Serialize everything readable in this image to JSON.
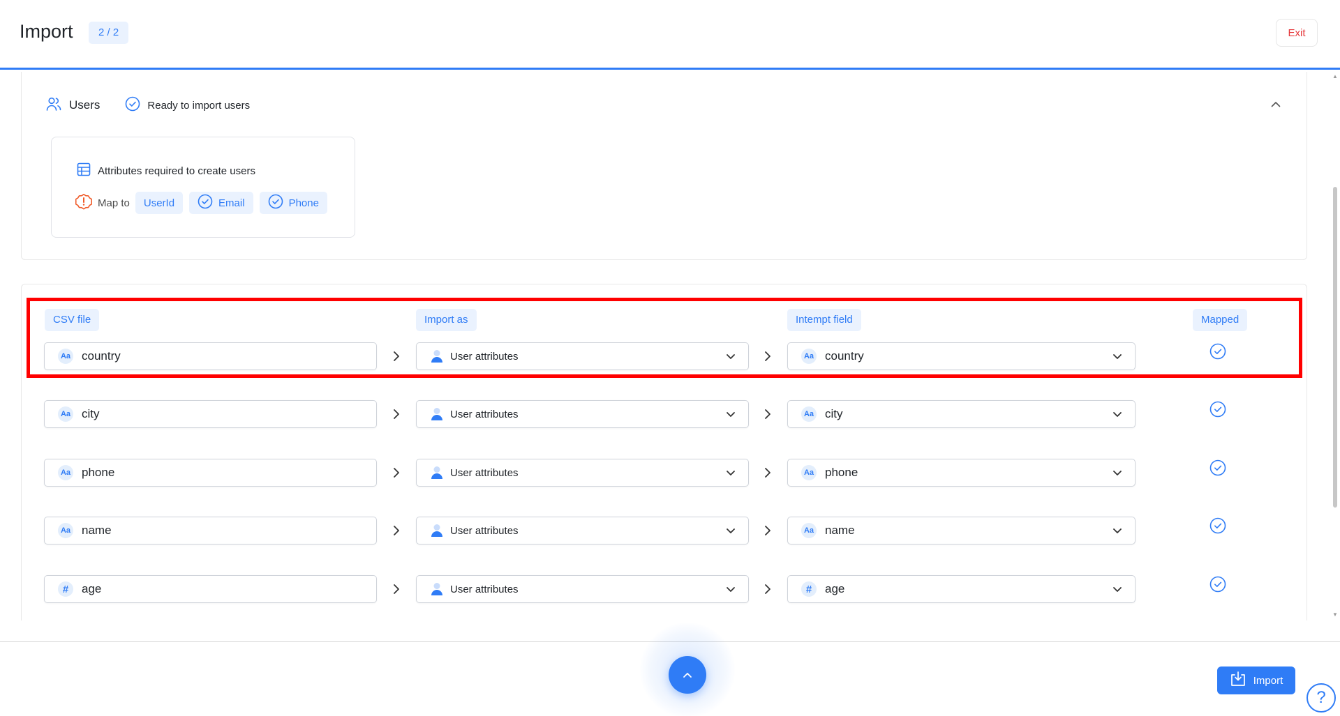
{
  "header": {
    "title": "Import",
    "step": "2 / 2",
    "exit_label": "Exit"
  },
  "users_section": {
    "title": "Users",
    "status": "Ready to import users",
    "required_card": {
      "title": "Attributes required to create users",
      "map_to_label": "Map to",
      "chips": [
        {
          "label": "UserId",
          "checked": false
        },
        {
          "label": "Email",
          "checked": true
        },
        {
          "label": "Phone",
          "checked": true
        }
      ]
    }
  },
  "mapping": {
    "columns": {
      "csv": "CSV file",
      "import_as": "Import as",
      "field": "Intempt field",
      "mapped": "Mapped"
    },
    "rows": [
      {
        "type": "text",
        "type_icon": "Aa",
        "csv": "country",
        "import_as": "User attributes",
        "field": "country",
        "mapped": true
      },
      {
        "type": "text",
        "type_icon": "Aa",
        "csv": "city",
        "import_as": "User attributes",
        "field": "city",
        "mapped": true
      },
      {
        "type": "text",
        "type_icon": "Aa",
        "csv": "phone",
        "import_as": "User attributes",
        "field": "phone",
        "mapped": true
      },
      {
        "type": "text",
        "type_icon": "Aa",
        "csv": "name",
        "import_as": "User attributes",
        "field": "name",
        "mapped": true
      },
      {
        "type": "number",
        "type_icon": "#",
        "csv": "age",
        "import_as": "User attributes",
        "field": "age",
        "mapped": true
      }
    ]
  },
  "footer": {
    "import_label": "Import",
    "help_label": "?"
  },
  "colors": {
    "accent": "#2f7cf6",
    "accent_light": "#eaf2fe",
    "warning": "#f05a28",
    "danger": "#e5383b",
    "highlight": "#ff0000"
  }
}
